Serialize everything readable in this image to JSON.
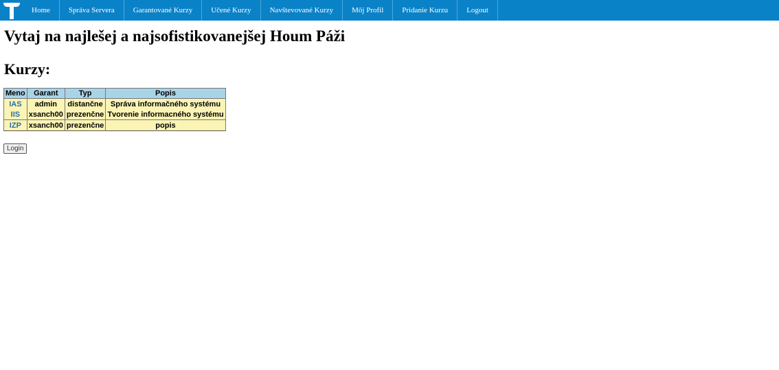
{
  "nav": {
    "items": [
      {
        "label": "Home"
      },
      {
        "label": "Správa Servera"
      },
      {
        "label": "Garantované Kurzy"
      },
      {
        "label": "Učené Kurzy"
      },
      {
        "label": "Navštevované Kurzy"
      },
      {
        "label": "Môj Profil"
      },
      {
        "label": "Pridanie Kurzu"
      },
      {
        "label": "Logout"
      }
    ]
  },
  "page": {
    "welcome": "Vytaj na najlešej a najsofistikovanejšej Houm Páži",
    "section_title": "Kurzy:"
  },
  "courses": {
    "headers": [
      "Meno",
      "Garant",
      "Typ",
      "Popis"
    ],
    "rows": [
      {
        "name": "IAS",
        "garant": "admin",
        "type": "distančne",
        "description": "Správa informačného systému"
      },
      {
        "name": "IIS",
        "garant": "xsanch00",
        "type": "prezenčne",
        "description": "Tvorenie informacného systému"
      },
      {
        "name": "IZP",
        "garant": "xsanch00",
        "type": "prezenčne",
        "description": "popis"
      }
    ]
  },
  "login": {
    "label": "Login"
  },
  "colors": {
    "navbar": "#0a82c8",
    "table_header": "#a9d3e6",
    "table_row": "#fbf4b4",
    "link": "#2a6ea6"
  }
}
